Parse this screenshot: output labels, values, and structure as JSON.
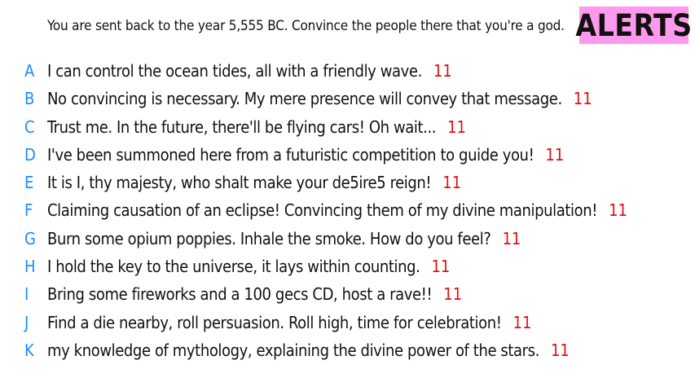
{
  "prompt": "You are sent back to the year 5,555 BC. Convince the people there that you're a god.",
  "badge": "ALERTS",
  "colors": {
    "badge_background": "#ff99ee",
    "letter": "#1a8cff",
    "score": "#e01010",
    "text": "#111111"
  },
  "answers": [
    {
      "letter": "A",
      "text": "I can control the ocean tides, all with a friendly wave.",
      "score": "11"
    },
    {
      "letter": "B",
      "text": "No convincing is necessary. My mere presence will convey that message.",
      "score": "11"
    },
    {
      "letter": "C",
      "text": "Trust me. In the future, there'll be flying cars! Oh wait...",
      "score": "11"
    },
    {
      "letter": "D",
      "text": "I've been summoned here from a futuristic competition to guide you!",
      "score": "11"
    },
    {
      "letter": "E",
      "text": "It is I, thy majesty, who shalt make your de5ire5 reign!",
      "score": "11"
    },
    {
      "letter": "F",
      "text": "Claiming causation of an eclipse! Convincing them of my divine manipulation!",
      "score": "11"
    },
    {
      "letter": "G",
      "text": "Burn some opium poppies. Inhale the smoke. How do you feel?",
      "score": "11"
    },
    {
      "letter": "H",
      "text": "I hold the key to the universe, it lays within counting.",
      "score": "11"
    },
    {
      "letter": "I",
      "text": "Bring some fireworks and a 100 gecs CD, host a rave!!",
      "score": "11"
    },
    {
      "letter": "J",
      "text": "Find a die nearby, roll persuasion. Roll high, time for celebration!",
      "score": "11"
    },
    {
      "letter": "K",
      "text": "my knowledge of mythology, explaining the divine power of the stars.",
      "score": "11"
    }
  ]
}
